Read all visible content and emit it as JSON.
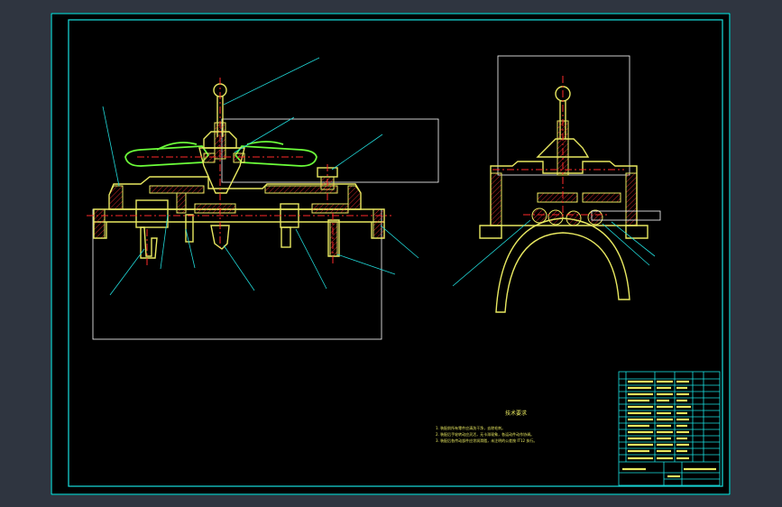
{
  "drawing": {
    "notes_heading": "技术要求",
    "notes": [
      "1. 装配前所有零件应清洗干净，去除毛刺。",
      "2. 装配后手轮转动应灵活，无卡滞现象，各运动件动作协调。",
      "3. 装配后各传动部件应涂润滑脂，未注明的公差按 IT12 执行。"
    ]
  },
  "colors": {
    "background": "#000000",
    "frame": "#17e0e0",
    "outline": "#e8e860",
    "handwheel": "#6cff3a",
    "centerline": "#ff2a2a",
    "leader": "#20d8d8",
    "dimension": "#ffffff",
    "viewer_background": "#2f3540"
  }
}
